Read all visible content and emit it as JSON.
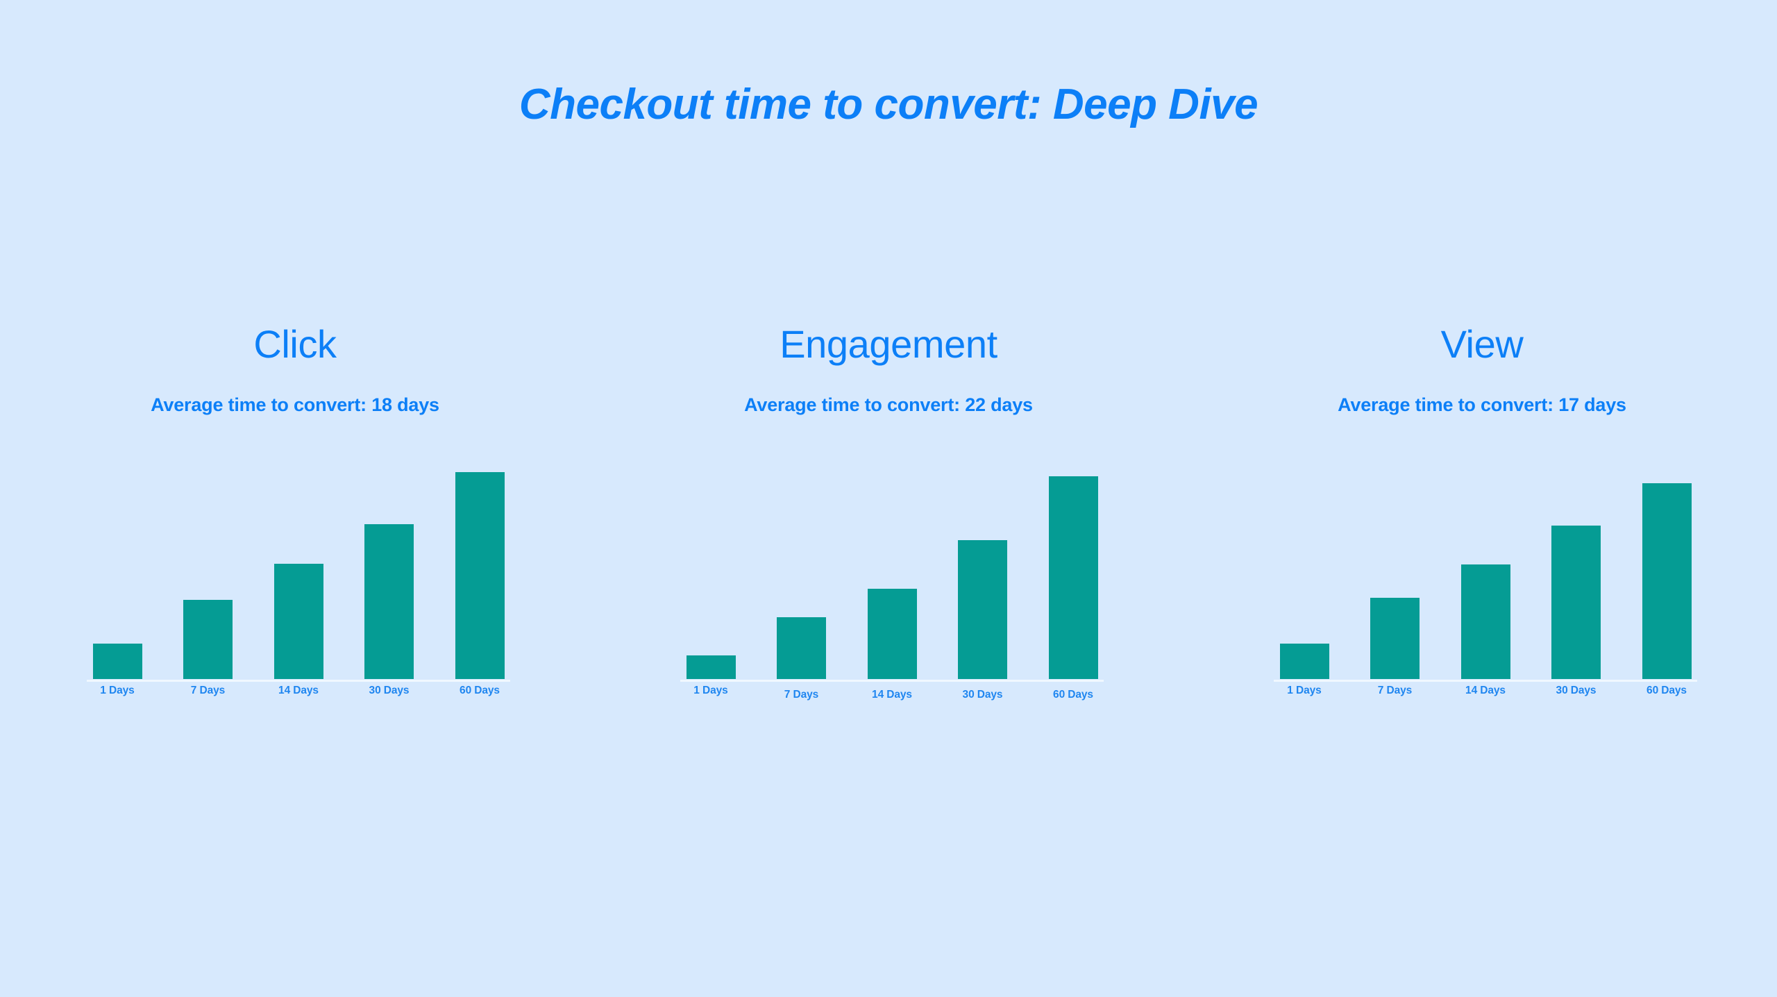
{
  "background_color": "#d7e9fd",
  "accent_color": "#0c7ff7",
  "bar_color": "#059c94",
  "axis_color": "#f0f8ff",
  "title": "Checkout time to convert: Deep Dive",
  "panels": [
    {
      "heading": "Click",
      "subtitle": "Average time to convert: 18 days"
    },
    {
      "heading": "Engagement",
      "subtitle": "Average time to convert: 22 days"
    },
    {
      "heading": "View",
      "subtitle": "Average time to convert: 17 days"
    }
  ],
  "chart_data": [
    {
      "type": "bar",
      "title": "Click",
      "subtitle": "Average time to convert: 18 days",
      "xlabel": "",
      "ylabel": "",
      "grid": false,
      "legend": "none",
      "categories": [
        "1 Days",
        "7 Days",
        "14 Days",
        "30 Days",
        "60 Days"
      ],
      "values": [
        51,
        114,
        166,
        223,
        298
      ],
      "ylim": [
        0,
        320
      ],
      "bar_color": "#059c94",
      "label_offsets": [
        0,
        0,
        0,
        0,
        0
      ]
    },
    {
      "type": "bar",
      "title": "Engagement",
      "subtitle": "Average time to convert: 22 days",
      "xlabel": "",
      "ylabel": "",
      "grid": false,
      "legend": "none",
      "categories": [
        "1 Days",
        "7 Days",
        "14 Days",
        "30 Days",
        "60 Days"
      ],
      "values": [
        34,
        89,
        130,
        200,
        292
      ],
      "ylim": [
        0,
        320
      ],
      "bar_color": "#059c94",
      "label_offsets": [
        0,
        6,
        6,
        6,
        6
      ]
    },
    {
      "type": "bar",
      "title": "View",
      "subtitle": "Average time to convert: 17 days",
      "xlabel": "",
      "ylabel": "",
      "grid": false,
      "legend": "none",
      "categories": [
        "1 Days",
        "7 Days",
        "14 Days",
        "30 Days",
        "60 Days"
      ],
      "values": [
        51,
        117,
        165,
        221,
        282
      ],
      "ylim": [
        0,
        320
      ],
      "bar_color": "#059c94",
      "label_offsets": [
        0,
        0,
        0,
        0,
        0
      ]
    }
  ]
}
